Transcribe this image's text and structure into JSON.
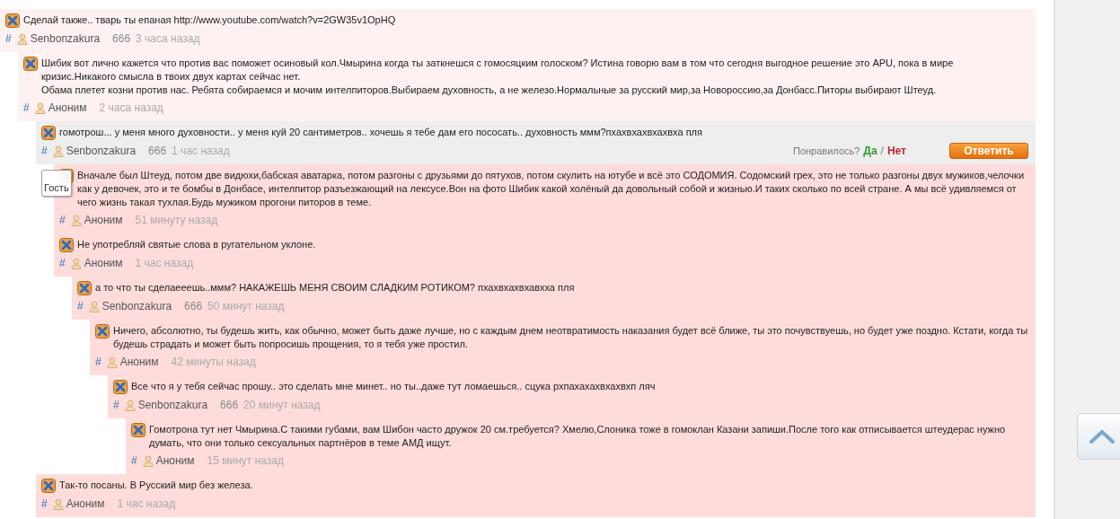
{
  "comments": [
    {
      "kind": "seen",
      "paragraphs": [
        "Сделай также.. тварь ты епаная http://www.youtube.com/watch?v=2GW35v1OpHQ"
      ],
      "meta": {
        "hash": "#",
        "author": "Senbonzakura",
        "score": "666",
        "time": "3 часа назад"
      },
      "children": [
        {
          "kind": "seen",
          "paragraphs": [
            "Шибик вот лично кажется что против вас поможет осиновый кол.Чмырина когда ты заткнешся с гомосяцким голоском? Истина говорю вам в том что сегодня выгодное решение это APU, пока в мире кризис.Никакого смысла в твоих двух картах сейчас нет.",
            "Обама плетет козни против нас. Ребята собираемся и мочим интелпиторов.Выбираем духовность, а не железо.Нормальные за русский мир,за Новороссию,за Донбасс.Питоры выбирают Штеуд."
          ],
          "meta": {
            "hash": "#",
            "author": "Аноним",
            "time": "2 часа назад"
          },
          "children": [
            {
              "kind": "focused",
              "paragraphs": [
                "гомотрош... у меня много духовности.. у меня куй 20 сантиметров.. хочешь я тебе дам его пососать.. духовность ммм?пхахвхахвхахвха пля"
              ],
              "meta": {
                "hash": "#",
                "author": "Senbonzakura",
                "score": "666",
                "time": "1 час назад"
              },
              "vote": {
                "question": "Понравилось?",
                "yes": "Да",
                "separator": "/",
                "no": "Нет"
              },
              "reply": "Ответить",
              "children": [
                {
                  "kind": "new",
                  "tooltip": "Гость",
                  "paragraphs": [
                    "Вначале был Штеуд, потом две видюхи,бабская аватарка, потом разгоны с друзьями до пятухов, потом скулить на ютубе и всё это СОДОМИЯ. Содомский грех, это не только разгоны двух мужиков,челочки как у девочек, это и те бомбы в Донбасе, интелпитор разъезжающий на лексусе.Вон на фото Шибик какой холёный да довольный собой и жизнью.И таких сколько по всей стране. А мы всё удивляемся от чего жизнь такая тухлая.Будь мужиком прогони питоров в теме."
                  ],
                  "meta": {
                    "hash": "#",
                    "author": "Аноним",
                    "time": "51 минуту назад"
                  }
                },
                {
                  "kind": "new",
                  "paragraphs": [
                    "Не употребляй святые слова в ругательном уклоне."
                  ],
                  "meta": {
                    "hash": "#",
                    "author": "Аноним",
                    "time": "1 час назад"
                  },
                  "children": [
                    {
                      "kind": "new",
                      "paragraphs": [
                        "а то что ты сделаееешь..ммм? НАКАЖЕШЬ МЕНЯ СВОИМ СЛАДКИМ РОТИКОМ? пхахвхахвхавхха пля"
                      ],
                      "meta": {
                        "hash": "#",
                        "author": "Senbonzakura",
                        "score": "666",
                        "time": "50 минут назад"
                      },
                      "children": [
                        {
                          "kind": "new",
                          "paragraphs": [
                            "Ничего, абсолютно, ты будешь жить, как обычно, может быть даже лучше, но с каждым днем неотвратимость наказания будет всё ближе, ты это почувствуешь, но будет уже поздно. Кстати, когда ты будешь страдать и может быть попросишь прощения, то я тебя уже простил."
                          ],
                          "meta": {
                            "hash": "#",
                            "author": "Аноним",
                            "time": "42 минуты назад"
                          },
                          "children": [
                            {
                              "kind": "new",
                              "paragraphs": [
                                "Все что я у тебя сейчас прошу.. это сделать мне минет.. но ты..даже тут ломаешься.. сцука рхпахахахвхахвхп ляч"
                              ],
                              "meta": {
                                "hash": "#",
                                "author": "Senbonzakura",
                                "score": "666",
                                "time": "20 минут назад"
                              },
                              "children": [
                                {
                                  "kind": "new",
                                  "paragraphs": [
                                    "Гомотрона тут нет Чмырина.С такими губами, вам Шибон часто дружок 20 см.требуется? Хмелю,Слоника тоже в гомоклан Казани запиши.После того как отписывается штеудерас нужно думать, что они только сексуальных партнёров в теме АМД ищут."
                                  ],
                                  "meta": {
                                    "hash": "#",
                                    "author": "Аноним",
                                    "time": "15 минут назад"
                                  }
                                }
                              ]
                            }
                          ]
                        }
                      ]
                    }
                  ]
                }
              ]
            },
            {
              "kind": "new",
              "paragraphs": [
                "Так-то посаны. В Русский мир без железа."
              ],
              "meta": {
                "hash": "#",
                "author": "Аноним",
                "time": "1 час назад"
              }
            }
          ]
        }
      ]
    }
  ]
}
